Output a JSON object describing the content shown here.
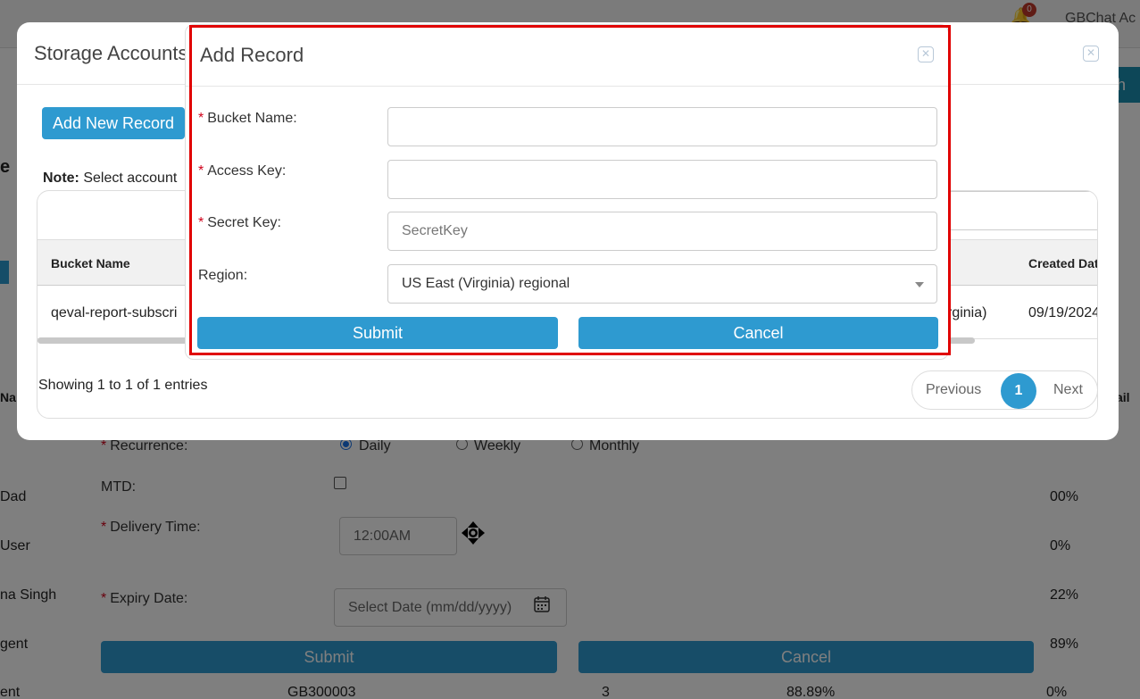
{
  "background": {
    "topbar": {
      "bell_badge": "0",
      "user_name": "GBChat Ac"
    },
    "teal_button_label": "h",
    "left_column_fragments": [
      "e",
      "Na",
      "Dad",
      "User",
      "na Singh",
      "gent",
      "ent"
    ],
    "right_column_fragments": [
      "ail",
      "00%",
      "0%",
      "22%",
      "89%",
      "0%"
    ],
    "bottom_row": {
      "code": "GB300003",
      "count": "3",
      "percent": "88.89%"
    },
    "form": {
      "recurrence_label": "Recurrence:",
      "recurrence_options": [
        "Daily",
        "Weekly",
        "Monthly"
      ],
      "recurrence_selected": "Daily",
      "mtd_label": "MTD:",
      "delivery_time_label": "Delivery Time:",
      "delivery_time_value": "12:00AM",
      "expiry_date_label": "Expiry Date:",
      "expiry_date_placeholder": "Select Date (mm/dd/yyyy)",
      "submit_label": "Submit",
      "cancel_label": "Cancel"
    }
  },
  "storage_modal": {
    "title": "Storage Accounts",
    "add_new_label": "Add New Record",
    "note_bold": "Note:",
    "note_text": " Select account",
    "table": {
      "headers": [
        "Bucket Name",
        "Created Dat"
      ],
      "row": {
        "bucket": "qeval-report-subscri",
        "region_tail": "rginia)",
        "created": "09/19/2024"
      }
    },
    "showing_text": "Showing 1 to 1 of 1 entries",
    "pager": {
      "previous": "Previous",
      "page": "1",
      "next": "Next"
    }
  },
  "add_record": {
    "title": "Add Record",
    "bucket_label": "Bucket Name:",
    "bucket_value": "",
    "access_label": "Access Key:",
    "access_value": "",
    "secret_label": "Secret Key:",
    "secret_placeholder": "SecretKey",
    "region_label": "Region:",
    "region_value": "US East (Virginia) regional",
    "submit_label": "Submit",
    "cancel_label": "Cancel"
  },
  "colors": {
    "primary": "#2e9ad0",
    "required": "#d0021b",
    "highlight": "#e00000"
  }
}
